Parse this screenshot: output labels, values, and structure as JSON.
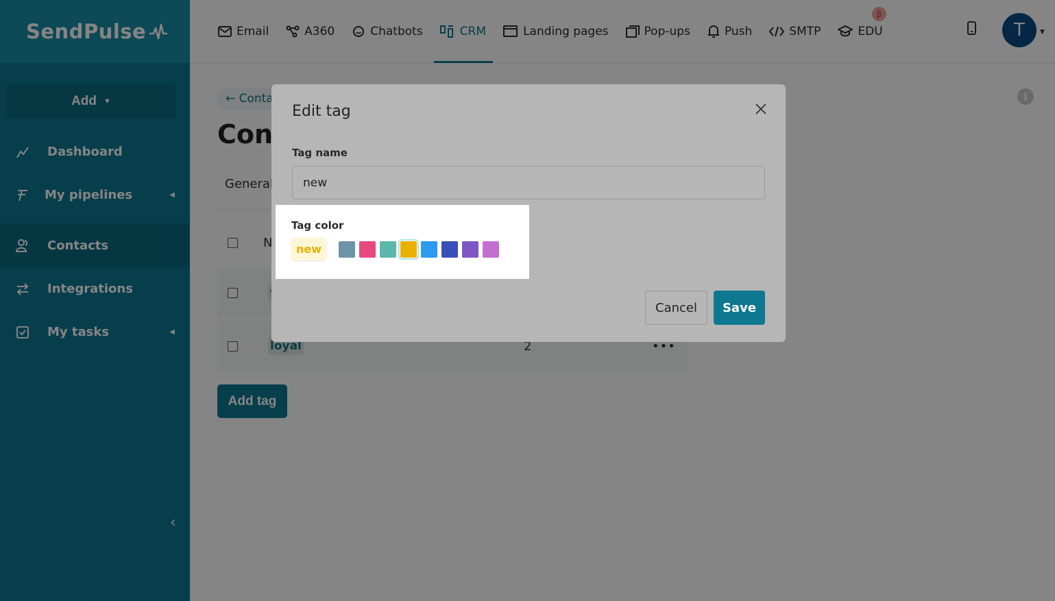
{
  "brand": {
    "logo_text": "SendPulse"
  },
  "sidebar": {
    "add_label": "Add",
    "items": [
      {
        "label": "Dashboard"
      },
      {
        "label": "My pipelines"
      },
      {
        "label": "Contacts"
      },
      {
        "label": "Integrations"
      },
      {
        "label": "My tasks"
      }
    ]
  },
  "topnav": {
    "items": [
      {
        "label": "Email"
      },
      {
        "label": "A360"
      },
      {
        "label": "Chatbots"
      },
      {
        "label": "CRM"
      },
      {
        "label": "Landing pages"
      },
      {
        "label": "Pop-ups"
      },
      {
        "label": "Push"
      },
      {
        "label": "SMTP"
      },
      {
        "label": "EDU"
      }
    ],
    "beta_badge": "β",
    "avatar_letter": "T"
  },
  "page": {
    "back_link": "← Conta",
    "title": "Cont",
    "tab_general": "General",
    "table_header_name": "N",
    "rows": [
      {
        "tag": "v",
        "count": "",
        "actions": ""
      },
      {
        "tag": "loyal",
        "count": "2",
        "actions": "•••"
      }
    ],
    "add_tag_label": "Add tag"
  },
  "modal": {
    "title": "Edit tag",
    "tag_name_label": "Tag name",
    "tag_name_value": "new",
    "tag_color_label": "Tag color",
    "preview_text": "new",
    "colors": [
      "#6d93a6",
      "#e84a7f",
      "#5cb8ad",
      "#e9b000",
      "#2c9af0",
      "#3b4fb8",
      "#7f57c4",
      "#c46fd0"
    ],
    "selected_color": "#e9b000",
    "cancel_label": "Cancel",
    "save_label": "Save"
  }
}
